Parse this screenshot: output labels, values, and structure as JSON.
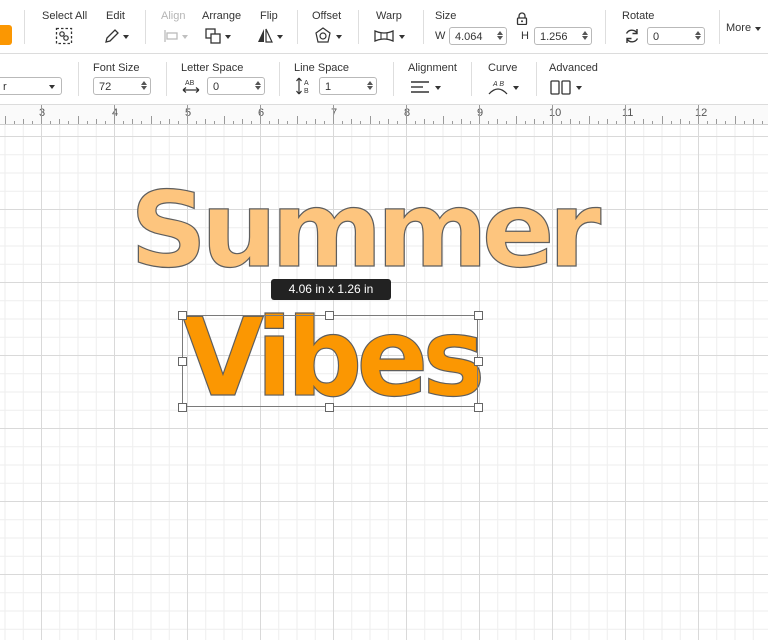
{
  "toolbar": {
    "select_all": "Select All",
    "edit": "Edit",
    "align": "Align",
    "arrange": "Arrange",
    "flip": "Flip",
    "offset": "Offset",
    "warp": "Warp",
    "size": "Size",
    "width_label": "W",
    "width_value": "4.064",
    "height_label": "H",
    "height_value": "1.256",
    "rotate": "Rotate",
    "rotate_value": "0",
    "more": "More",
    "accent_color": "#fb9702"
  },
  "text_toolbar": {
    "font_style_value": "r",
    "font_size_label": "Font Size",
    "font_size_value": "72",
    "letter_space_label": "Letter Space",
    "letter_space_value": "0",
    "line_space_label": "Line Space",
    "line_space_value": "1",
    "alignment_label": "Alignment",
    "curve_label": "Curve",
    "advanced_label": "Advanced"
  },
  "ruler": {
    "numbers": [
      "3",
      "4",
      "5",
      "6",
      "7",
      "8",
      "9",
      "10",
      "11",
      "12"
    ]
  },
  "canvas": {
    "text_line_1": "Summer",
    "text_line_2": "Vibes",
    "line_1_color": "#fdc57e",
    "line_2_color": "#fb9702",
    "size_tooltip": "4.06  in x 1.26  in"
  }
}
